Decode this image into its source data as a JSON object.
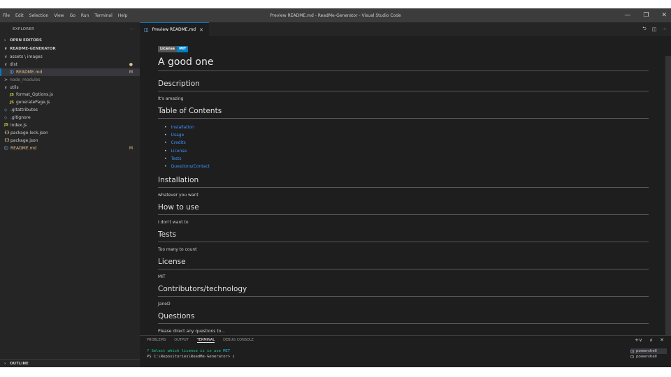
{
  "titlebar": {
    "menu": [
      "File",
      "Edit",
      "Selection",
      "View",
      "Go",
      "Run",
      "Terminal",
      "Help"
    ],
    "title": "Preview README.md - ReadMe-Generator - Visual Studio Code",
    "minimize": "—",
    "maximize": "❐",
    "close": "✕"
  },
  "sidebar": {
    "header": "EXPLORER",
    "more": "···",
    "open_editors": "OPEN EDITORS",
    "project": "README-GENERATOR",
    "tree": [
      {
        "label": "assets \\ images",
        "chev": "∨",
        "ico": "",
        "badge": "",
        "indent": 6
      },
      {
        "label": "dist",
        "chev": "∨",
        "ico": "",
        "badge": "●",
        "indent": 6
      },
      {
        "label": "README.md",
        "chev": "",
        "ico": "ⓘ",
        "badge": "M",
        "indent": 14,
        "selected": true
      },
      {
        "label": "node_modules",
        "chev": ">",
        "ico": "",
        "badge": "",
        "indent": 6,
        "dim": true
      },
      {
        "label": "utils",
        "chev": "∨",
        "ico": "",
        "badge": "",
        "indent": 6
      },
      {
        "label": "format_Options.js",
        "chev": "",
        "ico": "JS",
        "badge": "",
        "indent": 14,
        "js": true
      },
      {
        "label": "generatePage.js",
        "chev": "",
        "ico": "JS",
        "badge": "",
        "indent": 14,
        "js": true
      },
      {
        "label": ".gitattributes",
        "chev": "",
        "ico": "◇",
        "badge": "",
        "indent": 6
      },
      {
        "label": ".gitignore",
        "chev": "",
        "ico": "◇",
        "badge": "",
        "indent": 6
      },
      {
        "label": "index.js",
        "chev": "",
        "ico": "JS",
        "badge": "",
        "indent": 6,
        "js": true
      },
      {
        "label": "package-lock.json",
        "chev": "",
        "ico": "{}",
        "badge": "",
        "indent": 6,
        "json": true
      },
      {
        "label": "package.json",
        "chev": "",
        "ico": "{}",
        "badge": "",
        "indent": 6,
        "json": true
      },
      {
        "label": "README.md",
        "chev": "",
        "ico": "ⓘ",
        "badge": "M",
        "indent": 6,
        "modified": true
      }
    ],
    "outline": "OUTLINE"
  },
  "editor": {
    "tab_label": "Preview README.md",
    "tab_icon": "◫",
    "tab_close": "✕",
    "actions": [
      "⮌",
      "◫",
      "···"
    ]
  },
  "readme": {
    "badge_left": "License",
    "badge_right": "MIT",
    "title": "A good one",
    "description_h": "Description",
    "description": "It's amazing",
    "toc_h": "Table of Contents",
    "toc": [
      "Installation",
      "Usage",
      "Credits",
      "License",
      "Tests",
      "Questions/Contact"
    ],
    "install_h": "Installation",
    "install": "whatever you want",
    "usage_h": "How to use",
    "usage": "I don't want to",
    "tests_h": "Tests",
    "tests": "Too many to count",
    "license_h": "License",
    "license": "MIT",
    "contrib_h": "Contributors/technology",
    "contrib": "JaneD",
    "questions_h": "Questions",
    "questions": "Please direct any questions to..."
  },
  "panel": {
    "tabs": [
      "PROBLEMS",
      "OUTPUT",
      "TERMINAL",
      "DEBUG CONSOLE"
    ],
    "active_tab": "TERMINAL",
    "actions": [
      "+∨",
      "∧",
      "✕"
    ],
    "term_line1_prefix": "? Select which license is in use",
    "term_line1_answer": "MIT",
    "term_line2": "PS C:\\Repositories\\ReadMe-Generator> ",
    "terminals": [
      "powershell",
      "powershell"
    ]
  }
}
